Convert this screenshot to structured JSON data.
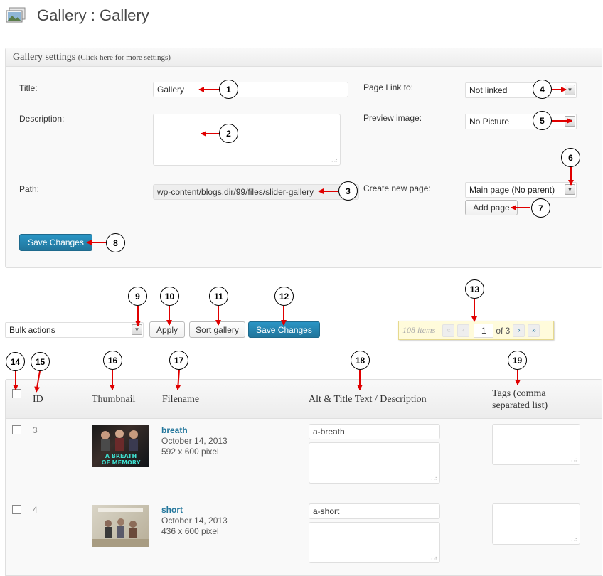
{
  "header": {
    "title": "Gallery : Gallery"
  },
  "settings": {
    "heading": "Gallery settings",
    "heading_hint": "(Click here for more settings)",
    "title_label": "Title:",
    "title_value": "Gallery",
    "description_label": "Description:",
    "description_value": "",
    "path_label": "Path:",
    "path_value": "wp-content/blogs.dir/99/files/slider-gallery",
    "page_link_label": "Page Link to:",
    "page_link_value": "Not linked",
    "preview_label": "Preview image:",
    "preview_value": "No Picture",
    "create_page_label": "Create new page:",
    "create_page_value": "Main page (No parent)",
    "add_page_label": "Add page",
    "save_label": "Save Changes"
  },
  "toolbar": {
    "bulk_actions": "Bulk actions",
    "apply_label": "Apply",
    "sort_label": "Sort gallery",
    "save_label": "Save Changes"
  },
  "pagination": {
    "count": "108 items",
    "first": "«",
    "prev": "‹",
    "current": "1",
    "of": "of 3",
    "next": "›",
    "last": "»"
  },
  "table": {
    "headers": {
      "id": "ID",
      "thumbnail": "Thumbnail",
      "filename": "Filename",
      "alt": "Alt & Title Text / Description",
      "tags_line1": "Tags (comma",
      "tags_line2": "separated list)"
    },
    "rows": [
      {
        "id": "3",
        "filename": "breath",
        "date": "October 14, 2013",
        "size": "592 x 600 pixel",
        "alt": "a-breath",
        "thumb_text": "A BREATH OF MEMORY"
      },
      {
        "id": "4",
        "filename": "short",
        "date": "October 14, 2013",
        "size": "436 x 600 pixel",
        "alt": "a-short",
        "thumb_text": ""
      }
    ]
  },
  "callouts": [
    "1",
    "2",
    "3",
    "4",
    "5",
    "6",
    "7",
    "8",
    "9",
    "10",
    "11",
    "12",
    "13",
    "14",
    "15",
    "16",
    "17",
    "18",
    "19"
  ],
  "colors": {
    "primary": "#21759b",
    "arrow": "#e00000",
    "pager_bg": "#fffbdb"
  }
}
